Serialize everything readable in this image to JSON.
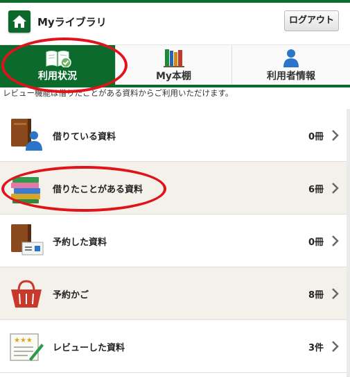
{
  "header": {
    "title": "Myライブラリ",
    "logout_label": "ログアウト"
  },
  "tabs": [
    {
      "label": "利用状況",
      "active": true
    },
    {
      "label": "My本棚",
      "active": false
    },
    {
      "label": "利用者情報",
      "active": false
    }
  ],
  "notice": "レビュー機能は借りたことがある資料からご利用いただけます。",
  "items": [
    {
      "label": "借りている資料",
      "count": "0冊"
    },
    {
      "label": "借りたことがある資料",
      "count": "6冊"
    },
    {
      "label": "予約した資料",
      "count": "0冊"
    },
    {
      "label": "予約かご",
      "count": "8冊"
    },
    {
      "label": "レビューした資料",
      "count": "3件"
    }
  ],
  "colors": {
    "brand_green": "#0c6b2c",
    "annotation_red": "#e0131a",
    "alt_row": "#f4f1ea"
  },
  "icons": [
    "home-icon",
    "book-check-icon",
    "bookshelf-icon",
    "user-icon",
    "book-person-icon",
    "book-stack-icon",
    "book-ticket-icon",
    "basket-icon",
    "review-stars-icon",
    "chevron-right-icon"
  ]
}
